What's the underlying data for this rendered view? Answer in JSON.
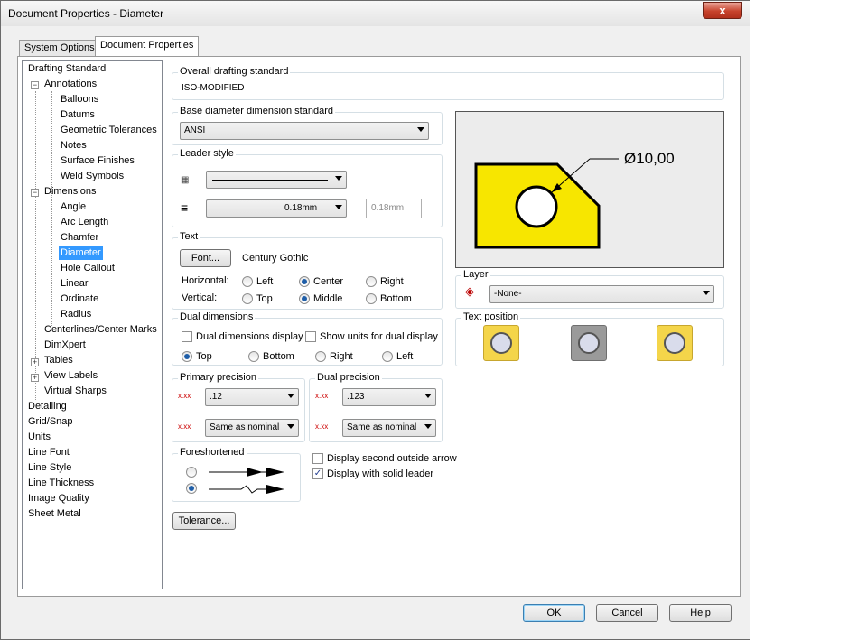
{
  "window": {
    "title": "Document Properties - Diameter",
    "close": "x"
  },
  "tabs": [
    {
      "label": "System Options"
    },
    {
      "label": "Document Properties"
    }
  ],
  "tree": {
    "items": [
      "Drafting Standard",
      "Annotations",
      "Balloons",
      "Datums",
      "Geometric Tolerances",
      "Notes",
      "Surface Finishes",
      "Weld Symbols",
      "Dimensions",
      "Angle",
      "Arc Length",
      "Chamfer",
      "Diameter",
      "Hole Callout",
      "Linear",
      "Ordinate",
      "Radius",
      "Centerlines/Center Marks",
      "DimXpert",
      "Tables",
      "View Labels",
      "Virtual Sharps",
      "Detailing",
      "Grid/Snap",
      "Units",
      "Line Font",
      "Line Style",
      "Line Thickness",
      "Image Quality",
      "Sheet Metal"
    ],
    "selected": "Diameter"
  },
  "overall": {
    "label": "Overall drafting standard",
    "value": "ISO-MODIFIED"
  },
  "base_diameter": {
    "label": "Base diameter dimension standard",
    "value": "ANSI"
  },
  "leader_style": {
    "label": "Leader style",
    "thickness": "0.18mm",
    "custom": "0.18mm"
  },
  "text": {
    "label": "Text",
    "font_button": "Font...",
    "font_name": "Century Gothic",
    "horizontal_label": "Horizontal:",
    "vertical_label": "Vertical:",
    "h_options": [
      "Left",
      "Center",
      "Right"
    ],
    "v_options": [
      "Top",
      "Middle",
      "Bottom"
    ]
  },
  "dual": {
    "label": "Dual dimensions",
    "display": "Dual dimensions display",
    "show_units": "Show units for dual display",
    "positions": [
      "Top",
      "Bottom",
      "Right",
      "Left"
    ]
  },
  "primary_precision": {
    "label": "Primary precision",
    "value": ".12",
    "tolerance": "Same as nominal"
  },
  "dual_precision": {
    "label": "Dual precision",
    "value": ".123",
    "tolerance": "Same as nominal"
  },
  "foreshortened": {
    "label": "Foreshortened"
  },
  "options": {
    "second_arrow": "Display second outside arrow",
    "solid_leader": "Display with solid leader"
  },
  "tolerance_button": "Tolerance...",
  "preview": {
    "dimension": "Ø10,00",
    "fill_color": "#f7e600"
  },
  "layer": {
    "label": "Layer",
    "value": "-None-"
  },
  "text_position": {
    "label": "Text position"
  },
  "buttons": {
    "ok": "OK",
    "cancel": "Cancel",
    "help": "Help"
  }
}
